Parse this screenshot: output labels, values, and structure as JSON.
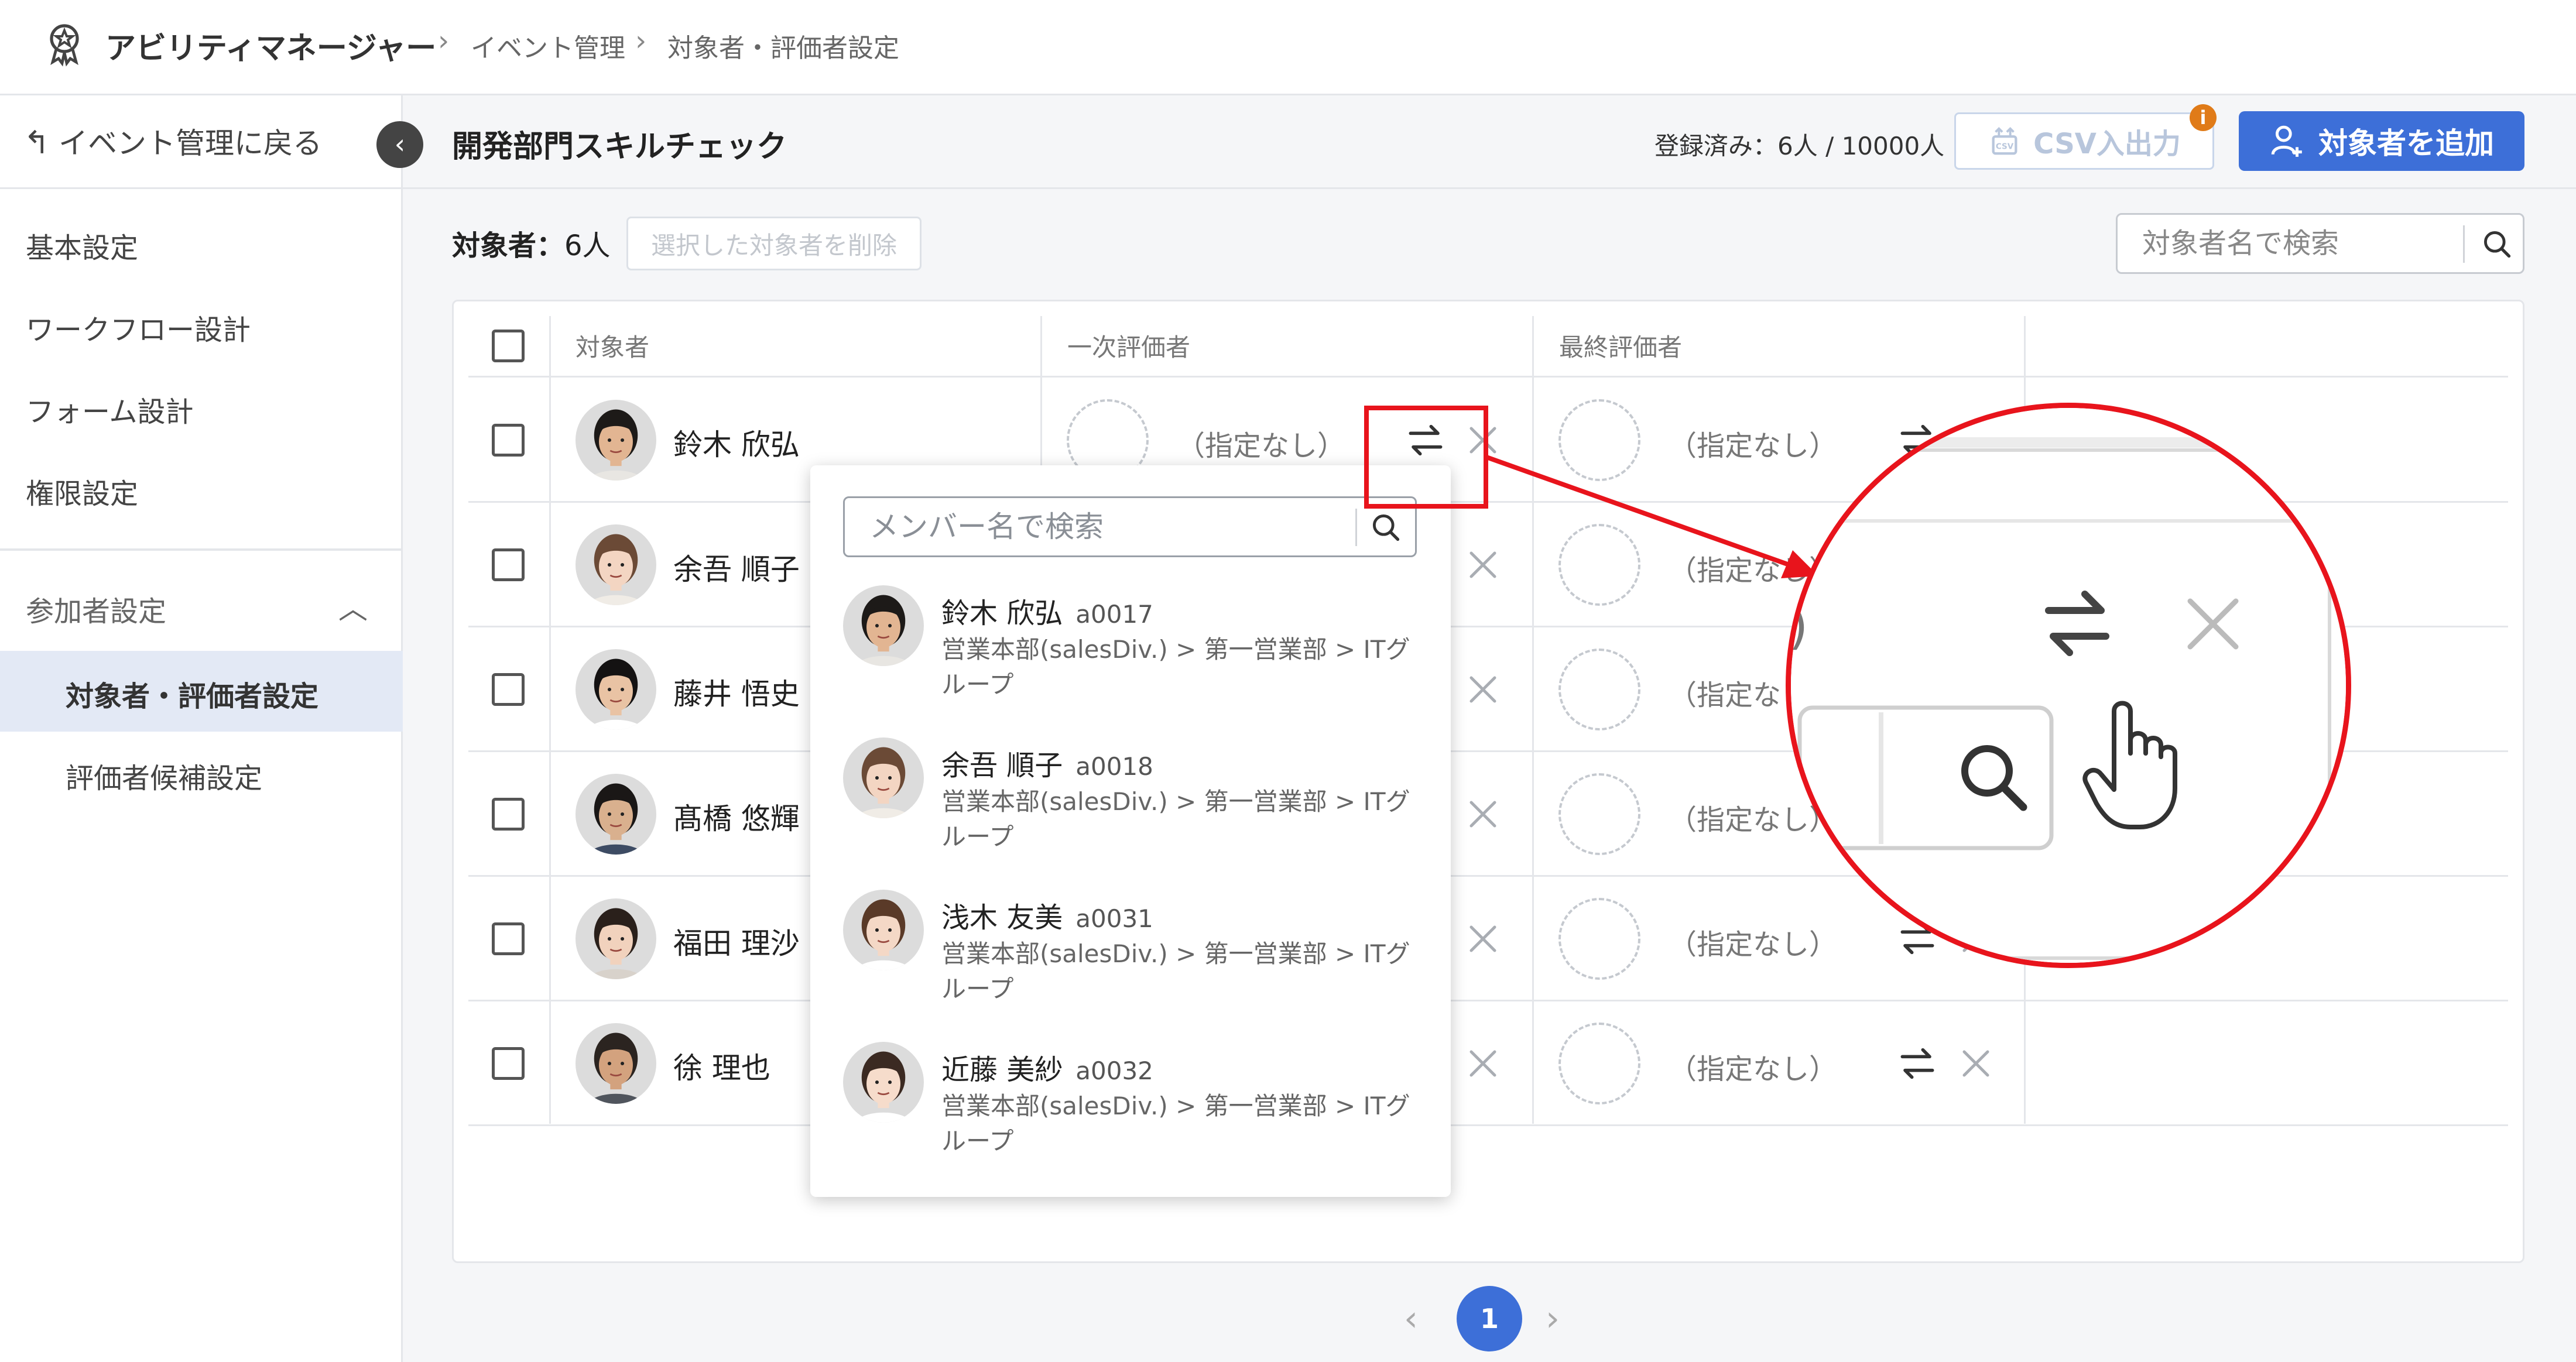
{
  "header": {
    "app_title": "アビリティマネージャー",
    "breadcrumbs": [
      "イベント管理",
      "対象者・評価者設定"
    ]
  },
  "sidebar": {
    "back_label": "イベント管理に戻る",
    "items": [
      "基本設定",
      "ワークフロー設計",
      "フォーム設計",
      "権限設定"
    ],
    "group_label": "参加者設定",
    "active_item": "対象者・評価者設定",
    "sub_item": "評価者候補設定"
  },
  "main": {
    "event_title": "開発部門スキルチェック",
    "registered": "登録済み：6人 / 10000人",
    "csv_button": "CSV入出力",
    "csv_badge": "i",
    "add_button": "対象者を追加",
    "targets_label": "対象者：",
    "targets_count": "6人",
    "delete_selected": "選択した対象者を削除",
    "search_placeholder": "対象者名で検索"
  },
  "table": {
    "columns": [
      "対象者",
      "一次評価者",
      "最終評価者"
    ],
    "unassigned": "（指定なし）",
    "rows": [
      {
        "name": "鈴木 欣弘",
        "skin": "#e2b592",
        "hair": "#1d1a18",
        "shirt": "#e8e6e2"
      },
      {
        "name": "余吾 順子",
        "skin": "#f3d5c2",
        "hair": "#6b4a36",
        "shirt": "#f0ece6"
      },
      {
        "name": "藤井 悟史",
        "skin": "#e9c3a4",
        "hair": "#141212",
        "shirt": "#ffffff"
      },
      {
        "name": "髙橋 悠輝",
        "skin": "#d9b08e",
        "hair": "#1a1716",
        "shirt": "#3d4b63"
      },
      {
        "name": "福田 理沙",
        "skin": "#f1d2bd",
        "hair": "#2a201b",
        "shirt": "#d8d2cb"
      },
      {
        "name": "徐 理也",
        "skin": "#d3a27e",
        "hair": "#2b2420",
        "shirt": "#50555d"
      }
    ]
  },
  "dropdown": {
    "search_placeholder": "メンバー名で検索",
    "members": [
      {
        "name": "鈴木 欣弘",
        "id": "a0017",
        "org": "営業本部(salesDiv.) > 第一営業部 > ITグループ",
        "skin": "#e2b592",
        "hair": "#1d1a18",
        "shirt": "#e8e6e2"
      },
      {
        "name": "余吾 順子",
        "id": "a0018",
        "org": "営業本部(salesDiv.) > 第一営業部 > ITグループ",
        "skin": "#f3d5c2",
        "hair": "#6b4a36",
        "shirt": "#f0ece6"
      },
      {
        "name": "浅木 友美",
        "id": "a0031",
        "org": "営業本部(salesDiv.) > 第一営業部 > ITグループ",
        "skin": "#f4d8c6",
        "hair": "#5a3a28",
        "shirt": "#ffffff"
      },
      {
        "name": "近藤 美紗",
        "id": "a0032",
        "org": "営業本部(salesDiv.) > 第一営業部 > ITグループ",
        "skin": "#f6dccb",
        "hair": "#3b2a22",
        "shirt": "#ffffff"
      }
    ]
  },
  "pagination": {
    "prev": "‹",
    "current": "1",
    "next": "›"
  },
  "colors": {
    "accent": "#3d6fd8",
    "annotation": "#e8141c",
    "badge": "#e07b18"
  }
}
